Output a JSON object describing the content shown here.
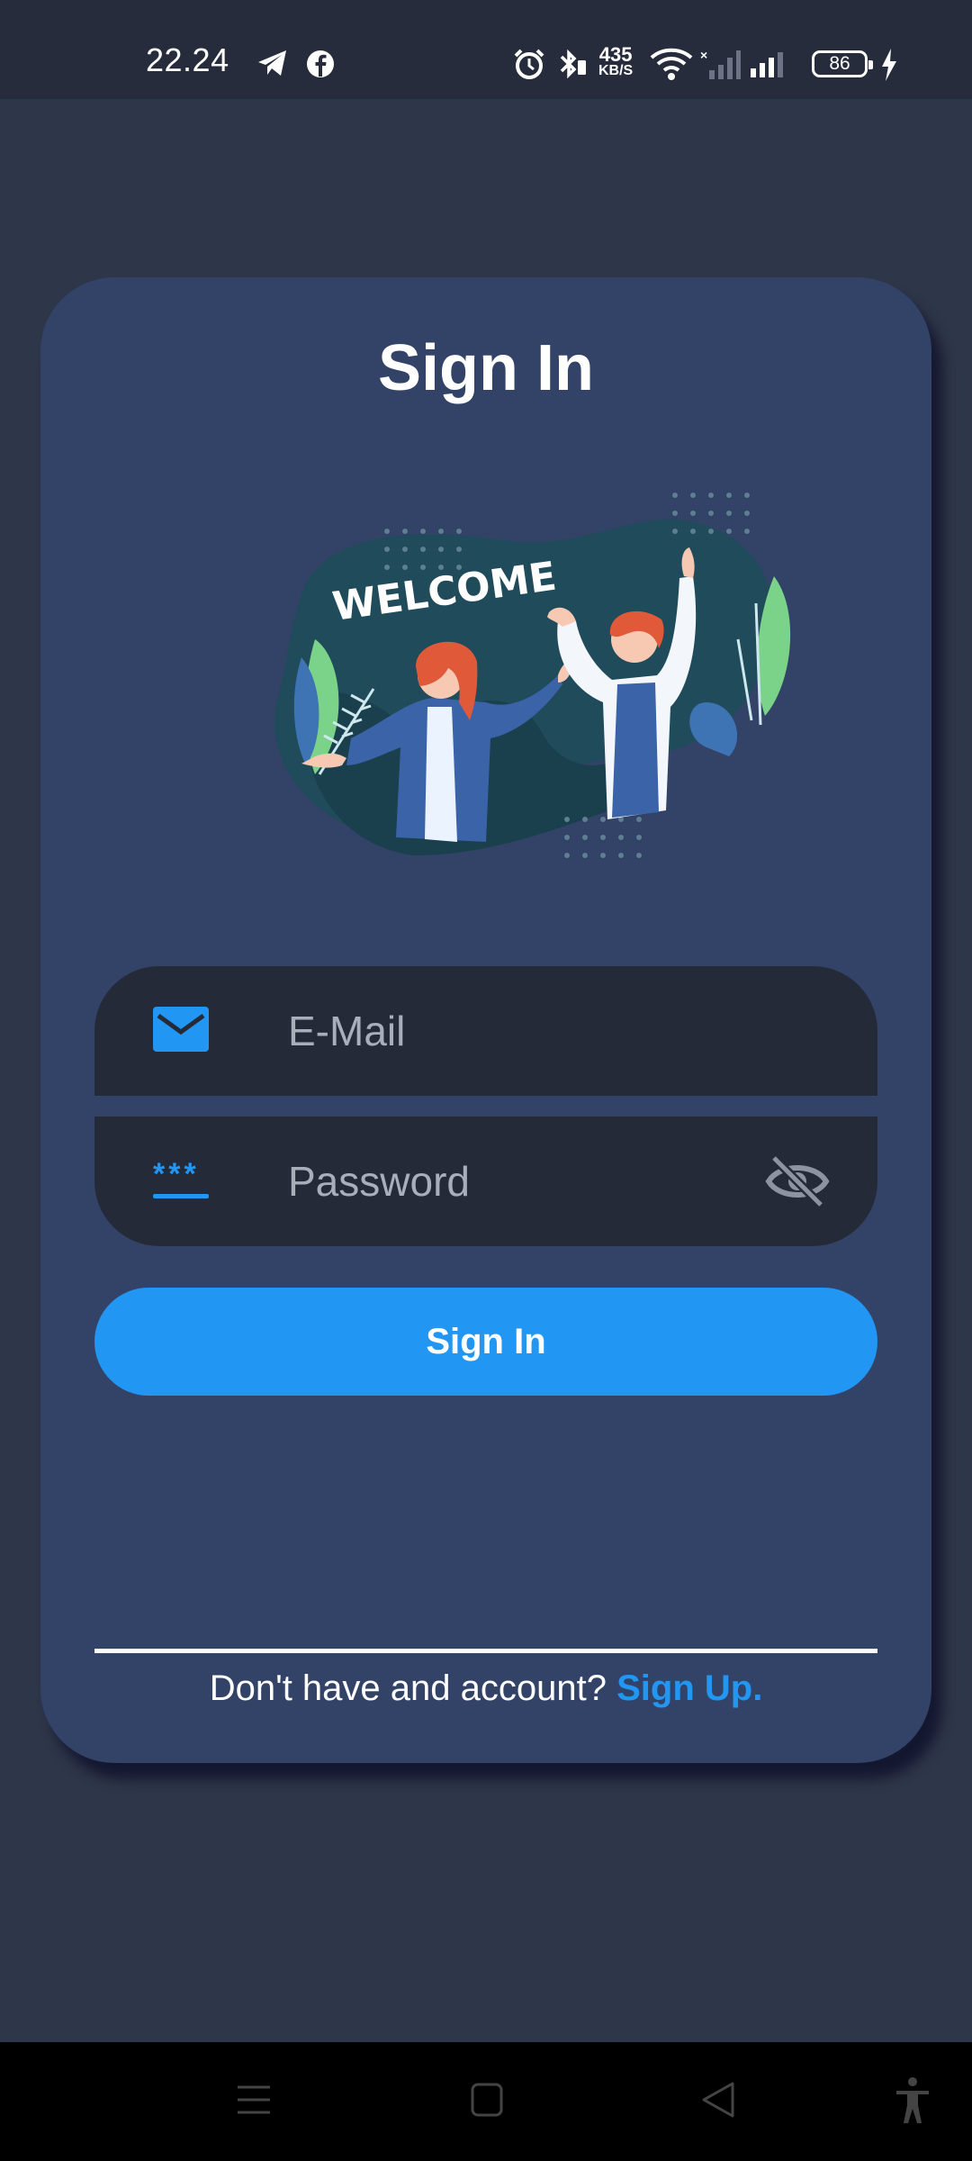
{
  "status_bar": {
    "time": "22.24",
    "net_speed_value": "435",
    "net_speed_unit": "KB/S",
    "battery": "86"
  },
  "card": {
    "title": "Sign In",
    "illustration_text": "WELCOME"
  },
  "form": {
    "email_placeholder": "E-Mail",
    "email_value": "",
    "password_placeholder": "Password",
    "password_value": "",
    "password_icon_text": "***",
    "submit_label": "Sign In"
  },
  "footer": {
    "prompt": "Don't have and account? ",
    "link": "Sign Up."
  },
  "colors": {
    "background": "#2e3649",
    "card": "#324367",
    "field": "#242a38",
    "accent": "#2196f3",
    "illustration_bg": "#1f4b5a"
  },
  "icons": {
    "status": [
      "telegram-icon",
      "facebook-icon",
      "alarm-icon",
      "bluetooth-icon",
      "wifi-icon",
      "signal-icon",
      "charging-icon"
    ],
    "fields": [
      "mail-icon",
      "password-icon",
      "eye-off-icon"
    ],
    "nav": [
      "menu-icon",
      "home-icon",
      "back-icon",
      "accessibility-icon"
    ]
  }
}
